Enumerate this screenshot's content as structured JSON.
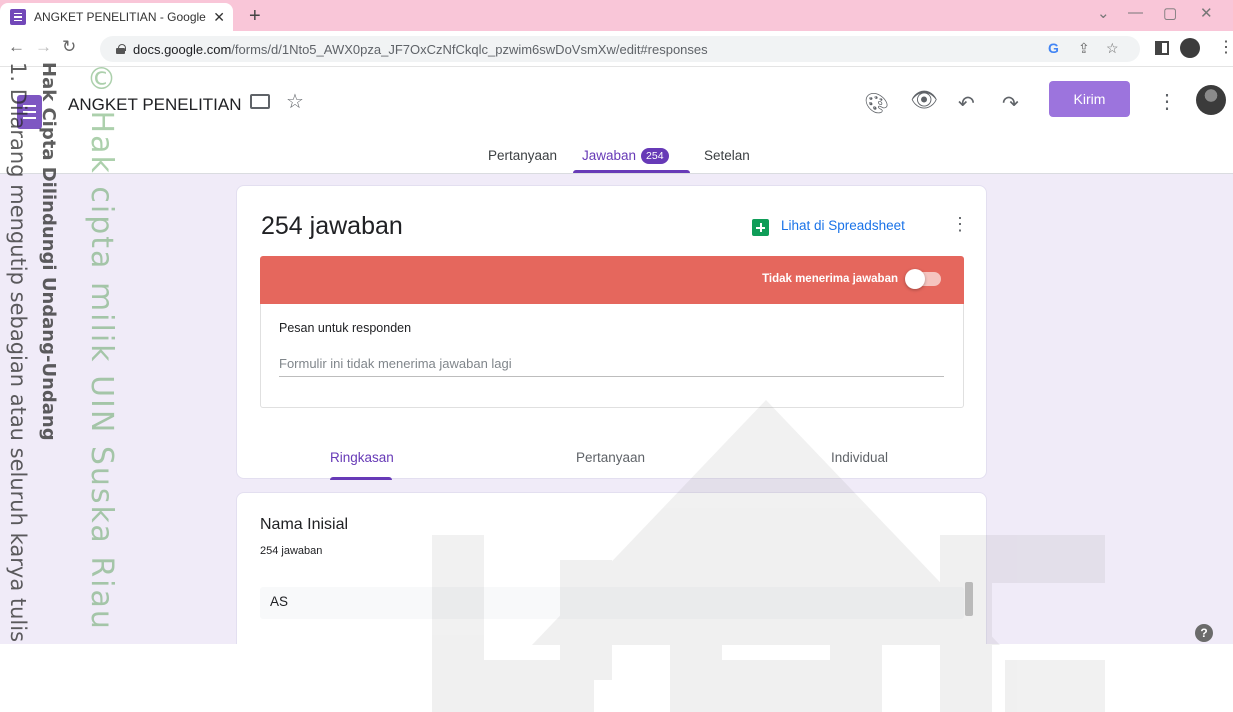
{
  "browser": {
    "tab_title": "ANGKET PENELITIAN - Google Fo",
    "url_host": "docs.google.com",
    "url_path": "/forms/d/1Nto5_AWX0pza_JF7OxCzNfCkqlc_pzwim6swDoVsmXw/edit#responses"
  },
  "header": {
    "title": "ANGKET PENELITIAN",
    "send_label": "Kirim"
  },
  "form_tabs": [
    {
      "label": "Pertanyaan"
    },
    {
      "label": "Jawaban",
      "badge": "254"
    },
    {
      "label": "Setelan"
    }
  ],
  "summary": {
    "response_count": "254 jawaban",
    "spreadsheet_link": "Lihat di Spreadsheet",
    "not_accepting": "Tidak menerima jawaban",
    "accepting_toggle_on": false,
    "message_label": "Pesan untuk responden",
    "message_value": "Formulir ini tidak menerima jawaban lagi"
  },
  "response_tabs": [
    {
      "label": "Ringkasan"
    },
    {
      "label": "Pertanyaan"
    },
    {
      "label": "Individual"
    }
  ],
  "question": {
    "title": "Nama Inisial",
    "count": "254 jawaban",
    "answers": [
      "AS"
    ]
  },
  "watermark": {
    "line1": "Hak Cipta Dilindungi Undang-Undang",
    "line2": "1. Dilarang mengutip sebagian atau seluruh karya tulis",
    "line3": "© Hak cipta milik UIN Suska Riau"
  },
  "colors": {
    "accent": "#673ab7",
    "send_button": "#9c74dd",
    "banner_red": "#e5675d",
    "page_bg": "#f0ebf8",
    "tabbar": "#f9c6d8"
  }
}
